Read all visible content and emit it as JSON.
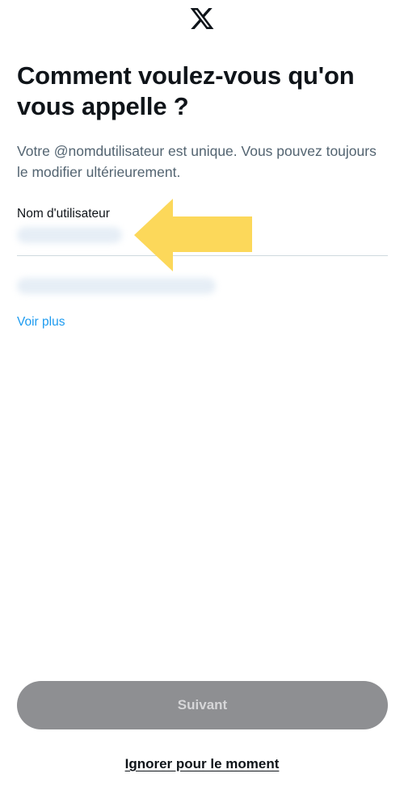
{
  "header": {
    "logo_icon": "x-logo-icon"
  },
  "main": {
    "title": "Comment voulez-vous qu'on vous appelle ?",
    "subtitle": "Votre @nomdutilisateur est unique. Vous pouvez toujours le modifier ultérieurement.",
    "username_field": {
      "label": "Nom d'utilisateur",
      "value": ""
    },
    "see_more_link": "Voir plus"
  },
  "footer": {
    "next_button": "Suivant",
    "skip_link": "Ignorer pour le moment"
  },
  "colors": {
    "text_primary": "#0f1419",
    "text_secondary": "#536471",
    "link": "#1d9bf0",
    "button_disabled_bg": "#8e8f92",
    "annotation_arrow": "#fcd85a"
  }
}
